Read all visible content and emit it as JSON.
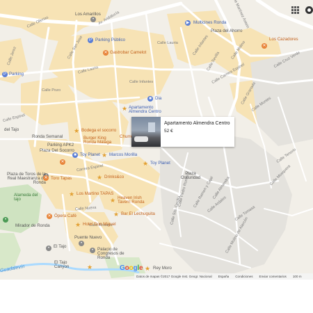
{
  "map": {
    "streets": [
      "Los Amarillos",
      "Av. Andalucía",
      "Calle Lorenzo Borrego",
      "Calle Jerez",
      "Calle Martínez Astein",
      "Av. Martínez Astein",
      "Calle Ollerias",
      "Calle San Jose",
      "Calle Lauria",
      "Calle Infantes",
      "Calle Sevilla",
      "Calle Carrera Espinel",
      "Calle Granada",
      "Calle Pozo",
      "Calle Lauria",
      "Calle Infantes",
      "Calle Molino",
      "Calle Cruz Verde",
      "Calle Montes",
      "Calle Espinel",
      "Calle Tenorio",
      "Carrera Espinel",
      "Calle Nueva",
      "Calle Rosario",
      "Calle San Vicente de Paul",
      "Calle Sta. Cecilia",
      "Calle Almendra",
      "Calle Jerez",
      "Calle Virgen",
      "Calle Lorenzo Borrego",
      "Calle Arriate",
      "Calle Jazmines",
      "Calle Doctor Vázquez",
      "Calle Ardales",
      "Calle Tomasa",
      "Calle Ramon y Cajal",
      "Calle Molino de Alarcón",
      "Calle Pedro Romero",
      "Calle Mosquera"
    ],
    "pois": {
      "multicines": "Multicines Ronda",
      "los_cazadores": "Los Cazadores",
      "plaza_ahorro": "Plaza del Ahorro",
      "parking_publico": "Parking Público",
      "gastrobar": "Gastrobar Camelot",
      "parking": "Parking",
      "dia": "Dia",
      "apartamento_almendra": "Apartamento Almendra Centro",
      "bodega": "Bodega el socorro",
      "burger_king": "Burger King Ronda Málaga",
      "parking_apk2": "Parking APK2",
      "plaza_socorro": "Plaza Del Socorro",
      "toy_planet_1": "Toy Planet",
      "marcos_morilla": "Marcos Morilla",
      "toy_planet_2": "Toy Planet",
      "ronda_semanal": "Ronda Semanal",
      "del_tajo": "del Tajo",
      "plaza_toros": "Plaza de Toros de la Real Maestranza de Ronda",
      "alameda": "Alameda del tajo",
      "toro_tapas": "Toro Tapas",
      "drinks": "Drinks&co",
      "los_martino": "Los Martino TAPAS",
      "heaven_irish": "Heaven Irish Tavern Ronda",
      "opera_cafe": "Ópera Café",
      "bar_lechuguita": "Bar El Lechuguita",
      "hotel_don_miguel": "Hotel Don Miguel",
      "mirador": "Mirador de Ronda",
      "el_tajo": "El Tajo",
      "puente_nuevo": "Puente Nuevo",
      "palacio_congresos": "Palacio de Congresos de Ronda",
      "el_tajo_canyon": "El Tajo Canyon",
      "rey_moro": "Rey Moro",
      "plaza_oscuridad": "Plaza Oscuridad",
      "churreria": "Churrería",
      "guadalevin": "Guadalevín"
    }
  },
  "popup": {
    "title": "Apartamento Almendra Centro",
    "price": "52 €"
  },
  "attribution": {
    "google_letters": [
      "G",
      "o",
      "o",
      "g",
      "l",
      "e"
    ],
    "map_data": "Datos de mapas ©2017 Google Inst. Geogr. Nacional",
    "country": "España",
    "terms": "Condiciones",
    "feedback": "Enviar comentarios",
    "scale": "100 m"
  },
  "colors": {
    "land": "#f2efe8",
    "block_yellow": "#f7e3b5",
    "road": "#ffffff",
    "park": "#cfe3c1",
    "water": "#aadaff",
    "orange_poi": "#e8843a",
    "blue_poi": "#5b7fd6"
  }
}
